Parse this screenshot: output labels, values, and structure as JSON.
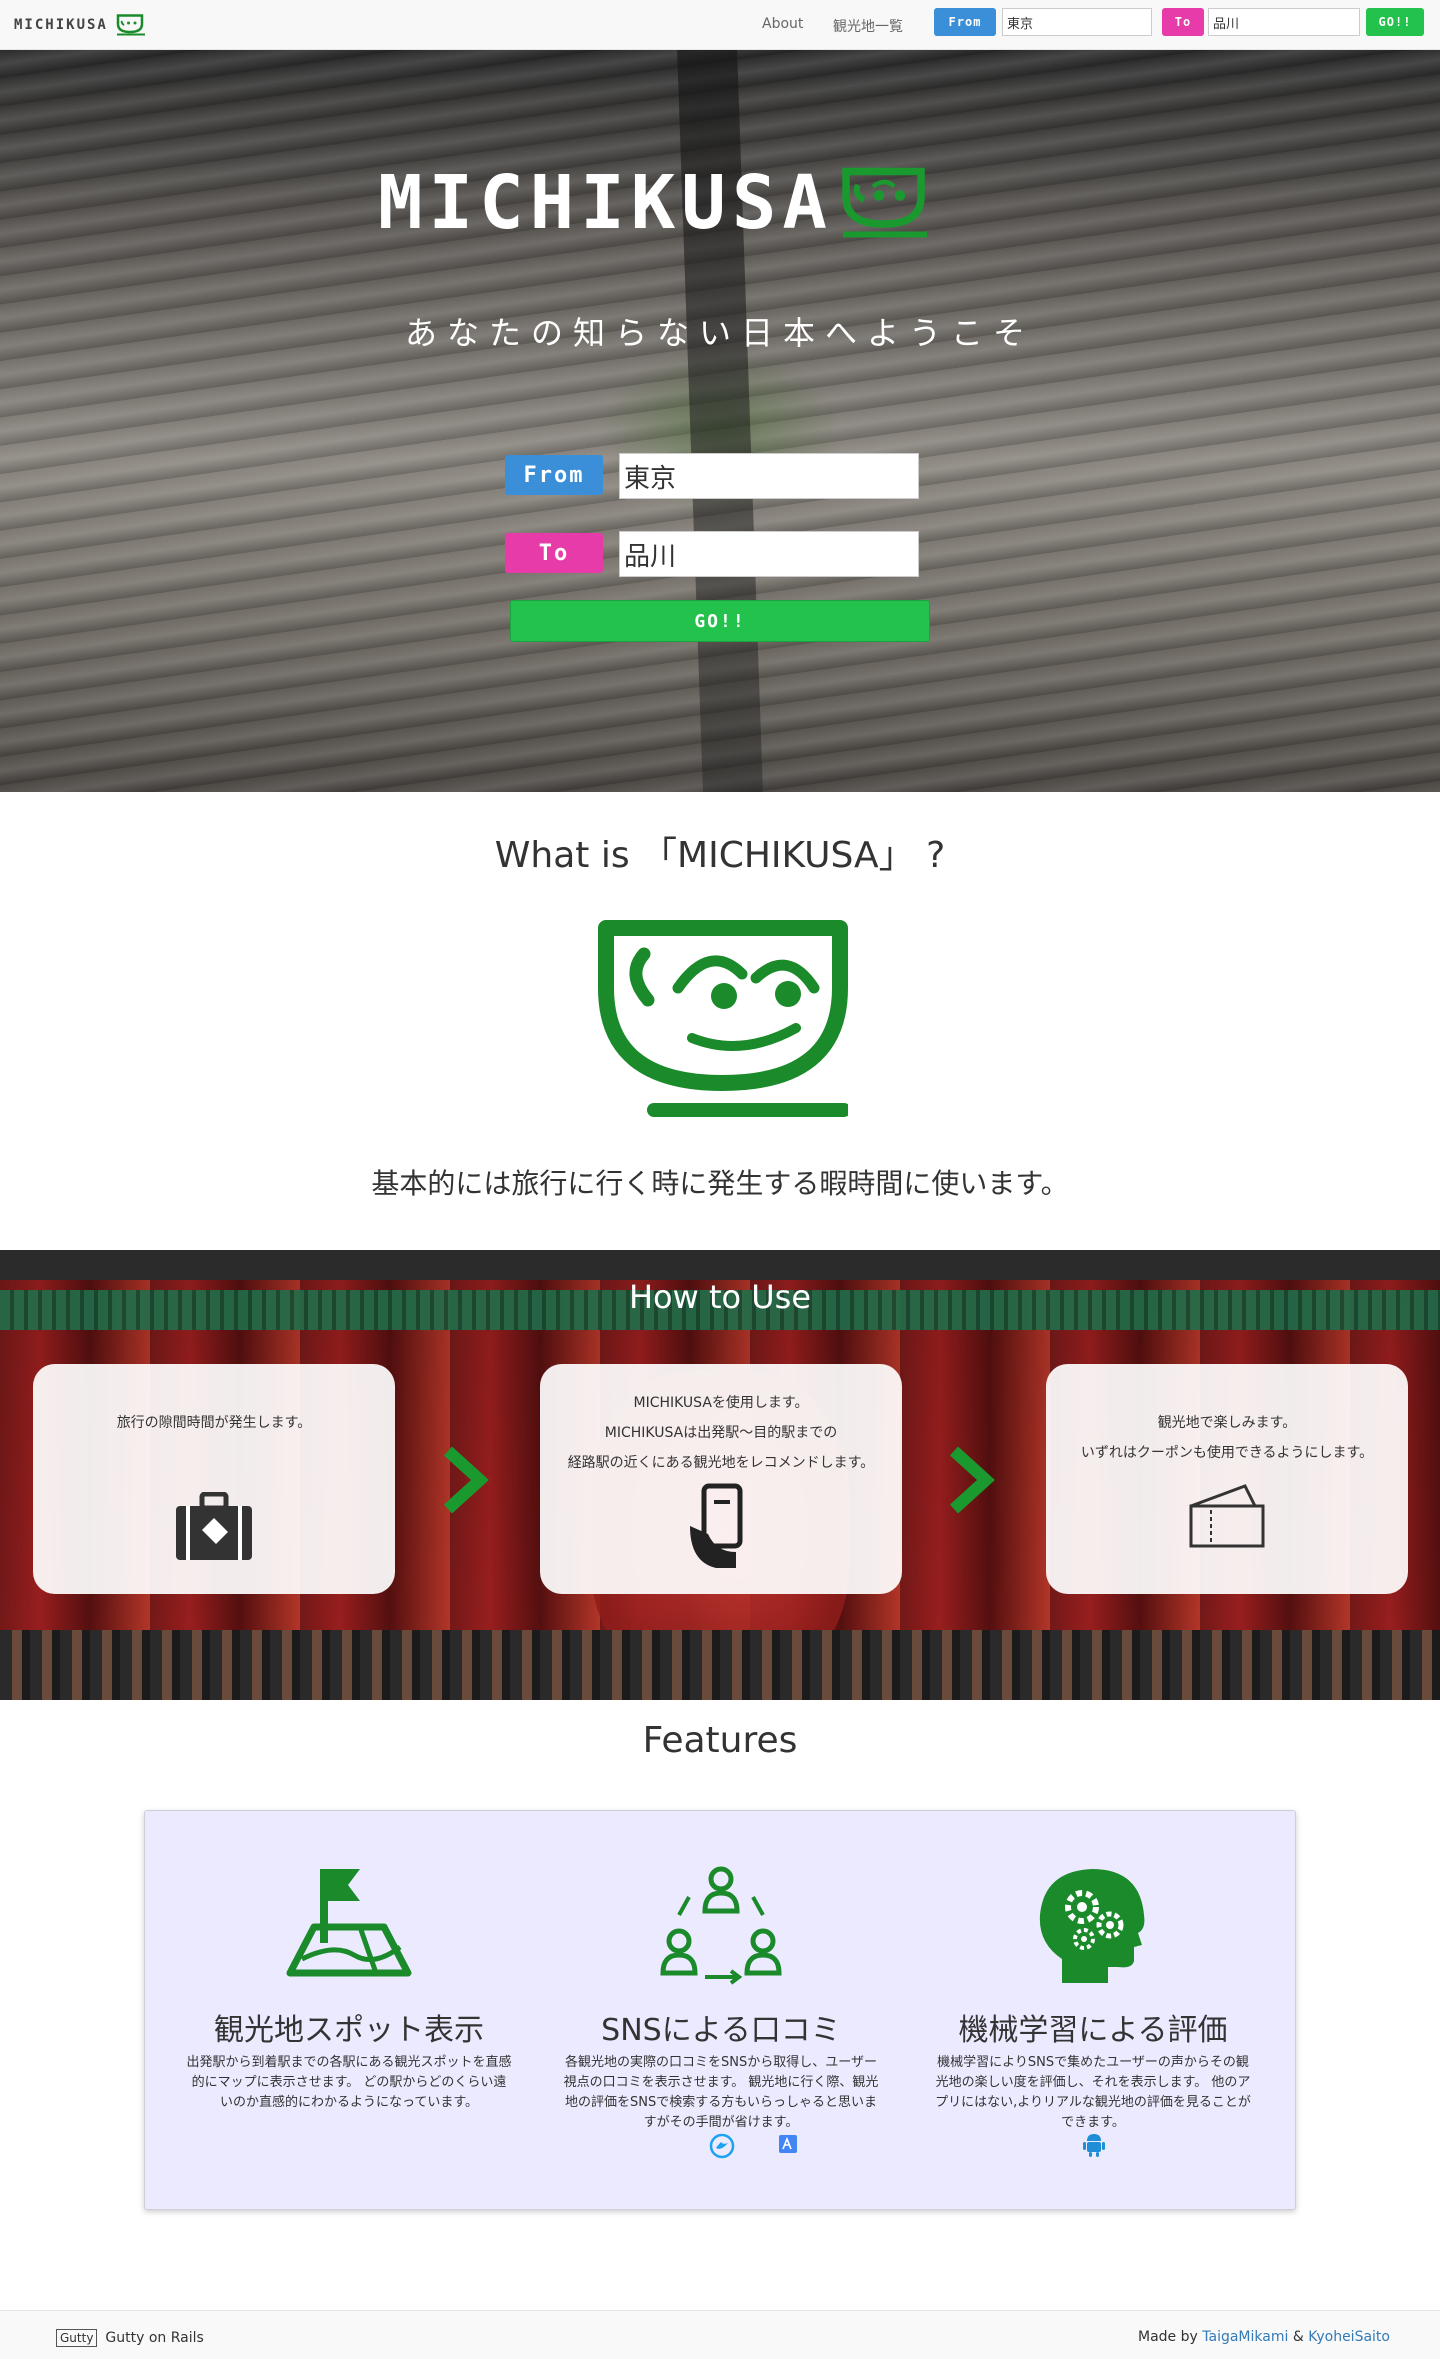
{
  "navbar": {
    "brand": "MICHIKUSA",
    "links": [
      "About",
      "観光地一覧"
    ],
    "from_label": "From",
    "from_value": "東京",
    "to_label": "To",
    "to_value": "品川",
    "go_label": "GO!!"
  },
  "hero": {
    "logo_text": "MICHIKUSA",
    "tagline": "あなたの知らない日本へようこそ",
    "from_label": "From",
    "from_value": "東京",
    "to_label": "To",
    "to_value": "品川",
    "go_label": "GO!!"
  },
  "what": {
    "title": "What is 「MICHIKUSA」 ?",
    "description": "基本的には旅行に行く時に発生する暇時間に使います。"
  },
  "howto": {
    "title": "How to Use",
    "steps": [
      {
        "lines": [
          "旅行の隙間時間が発生します。"
        ],
        "icon": "suitcase-icon"
      },
      {
        "lines": [
          "MICHIKUSAを使用します。",
          "MICHIKUSAは出発駅～目的駅までの",
          "経路駅の近くにある観光地をレコメンドします。"
        ],
        "icon": "phone-hand-icon"
      },
      {
        "lines": [
          "観光地で楽しみます。",
          "いずれはクーポンも使用できるようにします。"
        ],
        "icon": "ticket-icon"
      }
    ]
  },
  "features": {
    "title": "Features",
    "items": [
      {
        "name": "観光地スポット表示",
        "lines": [
          "出発駅から到着駅までの各駅にある観光スポットを直感",
          "的にマップに表示させます。 どの駅からどのくらい遠",
          "いのか直感的にわかるようになっています。"
        ],
        "icon": "map-flag-icon"
      },
      {
        "name": "SNSによる口コミ",
        "lines": [
          "各観光地の実際の口コミをSNSから取得し、ユーザー",
          "視点の口コミを表示させます。 観光地に行く際、観光",
          "地の評価をSNSで検索する方もいらっしゃると思いま",
          "すがその手間が省けます。"
        ],
        "icon": "people-cycle-icon"
      },
      {
        "name": "機械学習による評価",
        "lines": [
          "機械学習によりSNSで集めたユーザーの声からその観",
          "光地の楽しい度を評価し、それを表示します。 他のア",
          "プリにはない,よりリアルな観光地の評価を見ることが",
          "できます。"
        ],
        "icon": "brain-gears-icon"
      }
    ]
  },
  "footer": {
    "left_text": "Gutty on Rails",
    "logo_text": "Gutty",
    "made_by": "Made by",
    "author1": "TaigaMikami",
    "amp": "&",
    "author2": "KyoheiSaito"
  },
  "colors": {
    "from_blue": "#3a8fd8",
    "to_pink": "#e63ba8",
    "go_green": "#22c24d",
    "brand_green": "#1a8a2a"
  }
}
